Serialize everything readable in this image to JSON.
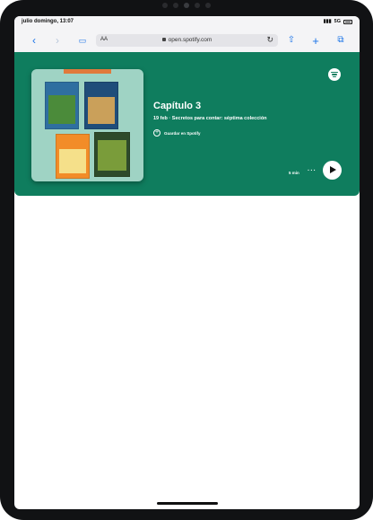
{
  "status_bar": {
    "time": "julio domingo, 13:07",
    "network": "5G",
    "signal": "signal-icon",
    "battery": "battery-icon"
  },
  "browser": {
    "text_size_label": "AA",
    "url": "open.spotify.com",
    "icons": {
      "back": "chevron-left-icon",
      "forward": "chevron-right-icon",
      "bookmarks": "book-icon",
      "lock": "lock-icon",
      "reload": "reload-icon",
      "share": "share-icon",
      "new_tab": "plus-icon",
      "tabs": "tabs-icon"
    }
  },
  "embed": {
    "background_color": "#0f7d5e",
    "episode_title": "Capítulo 3",
    "episode_meta": "19 feb · Secretos para contar: séptima colección",
    "save_label": "Guardar en Spotify",
    "duration": "5 min",
    "more_label": "···",
    "icons": {
      "logo": "spotify-logo-icon",
      "save": "plus-circle-icon",
      "play": "play-icon"
    }
  }
}
